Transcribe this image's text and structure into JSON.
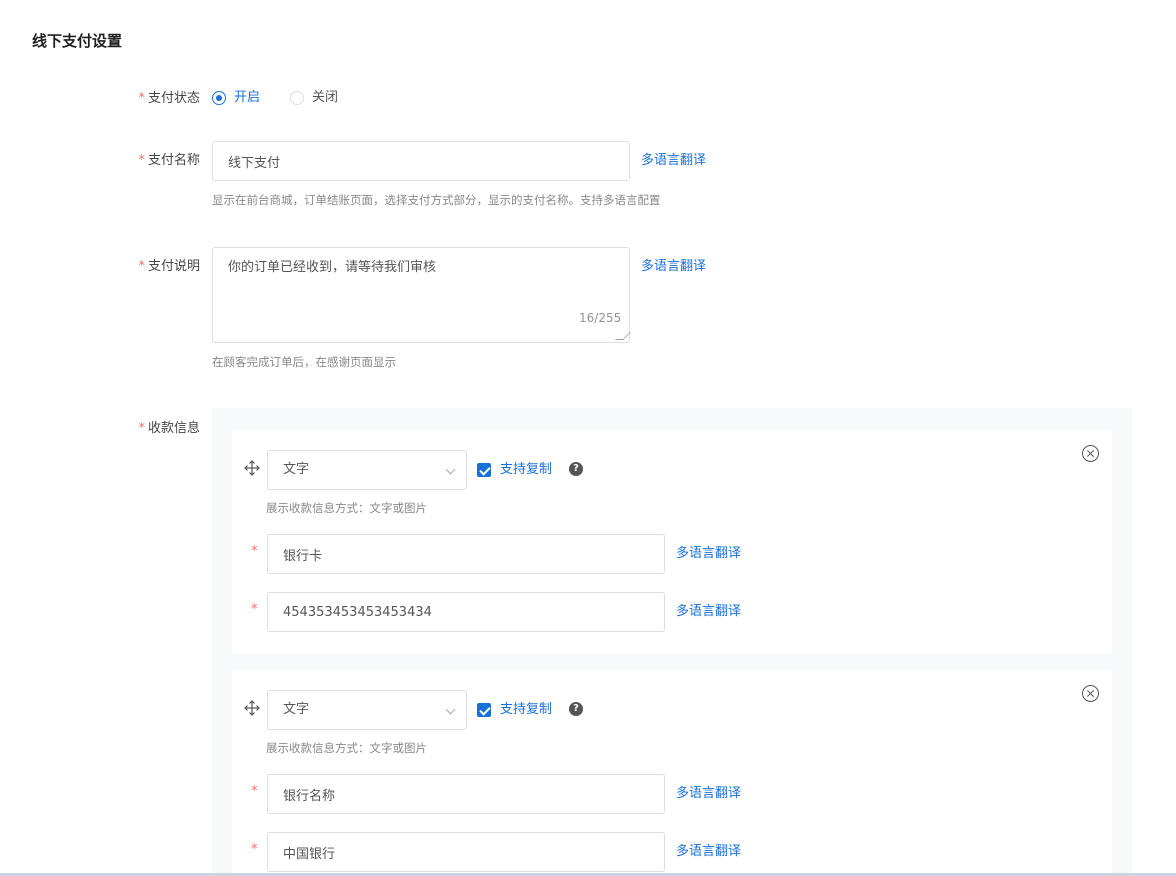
{
  "page": {
    "title": "线下支付设置"
  },
  "status": {
    "label": "支付状态",
    "options": [
      {
        "label": "开启",
        "selected": true
      },
      {
        "label": "关闭",
        "selected": false
      }
    ]
  },
  "name": {
    "label": "支付名称",
    "value": "线下支付",
    "translate": "多语言翻译",
    "hint": "显示在前台商城，订单结账页面，选择支付方式部分，显示的支付名称。支持多语言配置"
  },
  "desc": {
    "label": "支付说明",
    "value": "你的订单已经收到，请等待我们审核",
    "counter": "16/255",
    "translate": "多语言翻译",
    "hint": "在顾客完成订单后，在感谢页面显示"
  },
  "info": {
    "label": "收款信息",
    "cards": [
      {
        "type": "文字",
        "copy_label": "支持复制",
        "type_hint": "展示收款信息方式：文字或图片",
        "field1": "银行卡",
        "field2": "454353453453453434",
        "translate": "多语言翻译"
      },
      {
        "type": "文字",
        "copy_label": "支持复制",
        "type_hint": "展示收款信息方式：文字或图片",
        "field1": "银行名称",
        "field2": "中国银行",
        "translate": "多语言翻译"
      }
    ]
  },
  "colors": {
    "accent": "#1a6fd8",
    "required": "#f56c6c",
    "panel": "#f6f8fa"
  }
}
